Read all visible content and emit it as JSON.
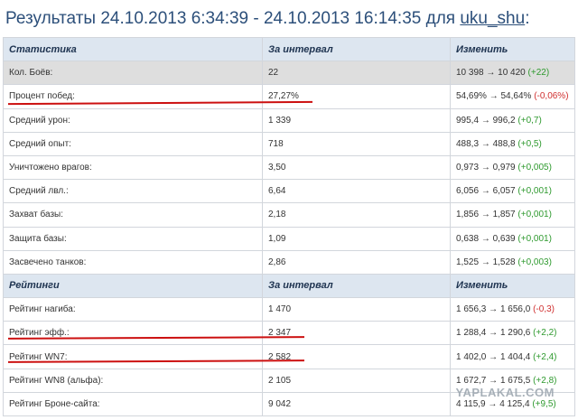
{
  "header": {
    "prefix": "Результаты 24.10.2013 6:34:39 - 24.10.2013 16:14:35 для",
    "user": "uku_shu",
    "suffix": ":"
  },
  "stats_section": {
    "headers": [
      "Статистика",
      "За интервал",
      "Изменить"
    ],
    "rows": [
      {
        "label": "Кол. Боёв:",
        "value": "22",
        "from": "10 398",
        "arrow": "→",
        "to": "10 420",
        "delta": "(+22)",
        "sign": "pos"
      },
      {
        "label": "Процент побед:",
        "value": "27,27%",
        "from": "54,69%",
        "arrow": "→",
        "to": "54,64%",
        "delta": "(-0,06%)",
        "sign": "neg"
      },
      {
        "label": "Средний урон:",
        "value": "1 339",
        "from": "995,4",
        "arrow": "→",
        "to": "996,2",
        "delta": "(+0,7)",
        "sign": "pos"
      },
      {
        "label": "Средний опыт:",
        "value": "718",
        "from": "488,3",
        "arrow": "→",
        "to": "488,8",
        "delta": "(+0,5)",
        "sign": "pos"
      },
      {
        "label": "Уничтожено врагов:",
        "value": "3,50",
        "from": "0,973",
        "arrow": "→",
        "to": "0,979",
        "delta": "(+0,005)",
        "sign": "pos"
      },
      {
        "label": "Средний лвл.:",
        "value": "6,64",
        "from": "6,056",
        "arrow": "→",
        "to": "6,057",
        "delta": "(+0,001)",
        "sign": "pos"
      },
      {
        "label": "Захват базы:",
        "value": "2,18",
        "from": "1,856",
        "arrow": "→",
        "to": "1,857",
        "delta": "(+0,001)",
        "sign": "pos"
      },
      {
        "label": "Защита базы:",
        "value": "1,09",
        "from": "0,638",
        "arrow": "→",
        "to": "0,639",
        "delta": "(+0,001)",
        "sign": "pos"
      },
      {
        "label": "Засвечено танков:",
        "value": "2,86",
        "from": "1,525",
        "arrow": "→",
        "to": "1,528",
        "delta": "(+0,003)",
        "sign": "pos"
      }
    ]
  },
  "ratings_section": {
    "headers": [
      "Рейтинги",
      "За интервал",
      "Изменить"
    ],
    "rows": [
      {
        "label": "Рейтинг нагиба:",
        "value": "1 470",
        "from": "1 656,3",
        "arrow": "→",
        "to": "1 656,0",
        "delta": "(-0,3)",
        "sign": "neg"
      },
      {
        "label": "Рейтинг эфф.:",
        "value": "2 347",
        "from": "1 288,4",
        "arrow": "→",
        "to": "1 290,6",
        "delta": "(+2,2)",
        "sign": "pos"
      },
      {
        "label": "Рейтинг WN7:",
        "value": "2 582",
        "from": "1 402,0",
        "arrow": "→",
        "to": "1 404,4",
        "delta": "(+2,4)",
        "sign": "pos"
      },
      {
        "label": "Рейтинг WN8 (альфа):",
        "value": "2 105",
        "from": "1 672,7",
        "arrow": "→",
        "to": "1 675,5",
        "delta": "(+2,8)",
        "sign": "pos"
      },
      {
        "label": "Рейтинг Броне-сайта:",
        "value": "9 042",
        "from": "4 115,9",
        "arrow": "→",
        "to": "4 125,4",
        "delta": "(+9,5)",
        "sign": "pos"
      }
    ]
  },
  "watermark": "YAPLAKAL.COM",
  "colors": {
    "positive": "#2f9a2f",
    "negative": "#d03030",
    "header_bg": "#dde6f0",
    "title": "#2c4f7a",
    "underline": "#cc1010"
  }
}
